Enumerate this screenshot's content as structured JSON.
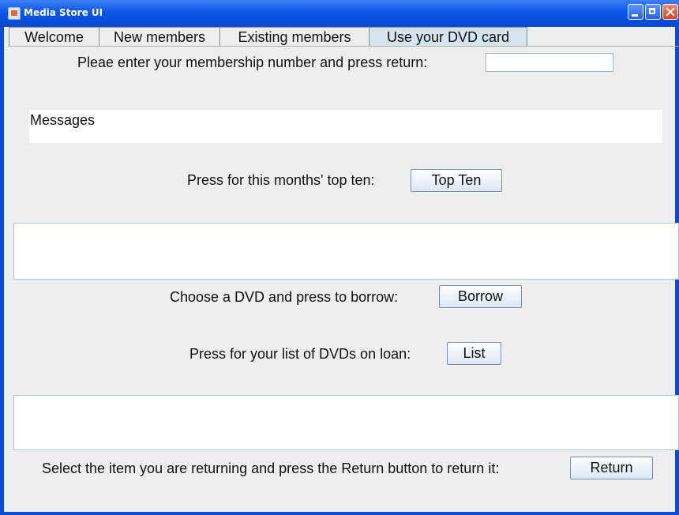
{
  "window": {
    "title": "Media Store UI"
  },
  "tabs": [
    {
      "label": "Welcome"
    },
    {
      "label": "New members"
    },
    {
      "label": "Existing members"
    },
    {
      "label": "Use your DVD card"
    }
  ],
  "membership": {
    "prompt": "Pleae enter your membership number and press return:",
    "value": ""
  },
  "messages": {
    "label": "Messages"
  },
  "top_ten": {
    "prompt": "Press for this months' top ten:",
    "button": "Top Ten"
  },
  "borrow": {
    "prompt": "Choose a DVD and press to borrow:",
    "button": "Borrow"
  },
  "list": {
    "prompt": "Press for your list of DVDs on loan:",
    "button": "List"
  },
  "return_item": {
    "prompt": "Select the item you are returning and press the Return button to return it:",
    "button": "Return"
  }
}
